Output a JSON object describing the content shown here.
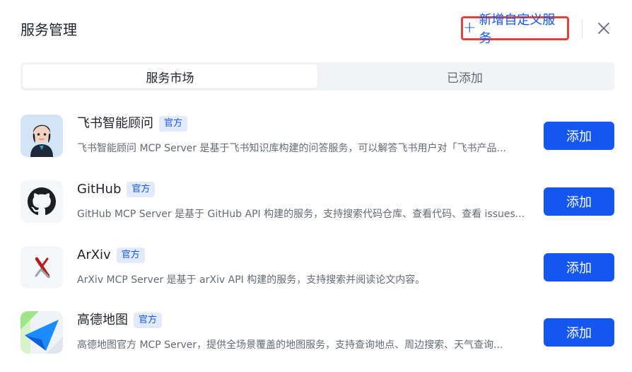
{
  "header": {
    "title": "服务管理",
    "add_custom_label": "新增自定义服务",
    "add_custom_icon": "plus-icon",
    "close_icon": "close-icon"
  },
  "tabs": [
    {
      "label": "服务市场",
      "active": true
    },
    {
      "label": "已添加",
      "active": false
    }
  ],
  "services": [
    {
      "name": "飞书智能顾问",
      "badge": "官方",
      "description": "飞书智能顾问 MCP Server 是基于飞书知识库构建的问答服务，可以解答飞书用户对「飞书产品...",
      "button": "添加",
      "icon": "assistant-avatar-icon"
    },
    {
      "name": "GitHub",
      "badge": "官方",
      "description": "GitHub MCP Server 是基于 GitHub API 构建的服务，支持搜索代码仓库、查看代码、查看 issues...",
      "button": "添加",
      "icon": "github-icon"
    },
    {
      "name": "ArXiv",
      "badge": "官方",
      "description": "ArXiv MCP Server 是基于 arXiv API 构建的服务，支持搜索并阅读论文内容。",
      "button": "添加",
      "icon": "arxiv-icon"
    },
    {
      "name": "高德地图",
      "badge": "官方",
      "description": "高德地图官方 MCP Server，提供全场景覆盖的地图服务，支持查询地点、周边搜索、天气查询...",
      "button": "添加",
      "icon": "amap-icon"
    }
  ],
  "colors": {
    "accent": "#1456f0",
    "badge_bg": "#e1eaff",
    "highlight_border": "#e5413e"
  }
}
